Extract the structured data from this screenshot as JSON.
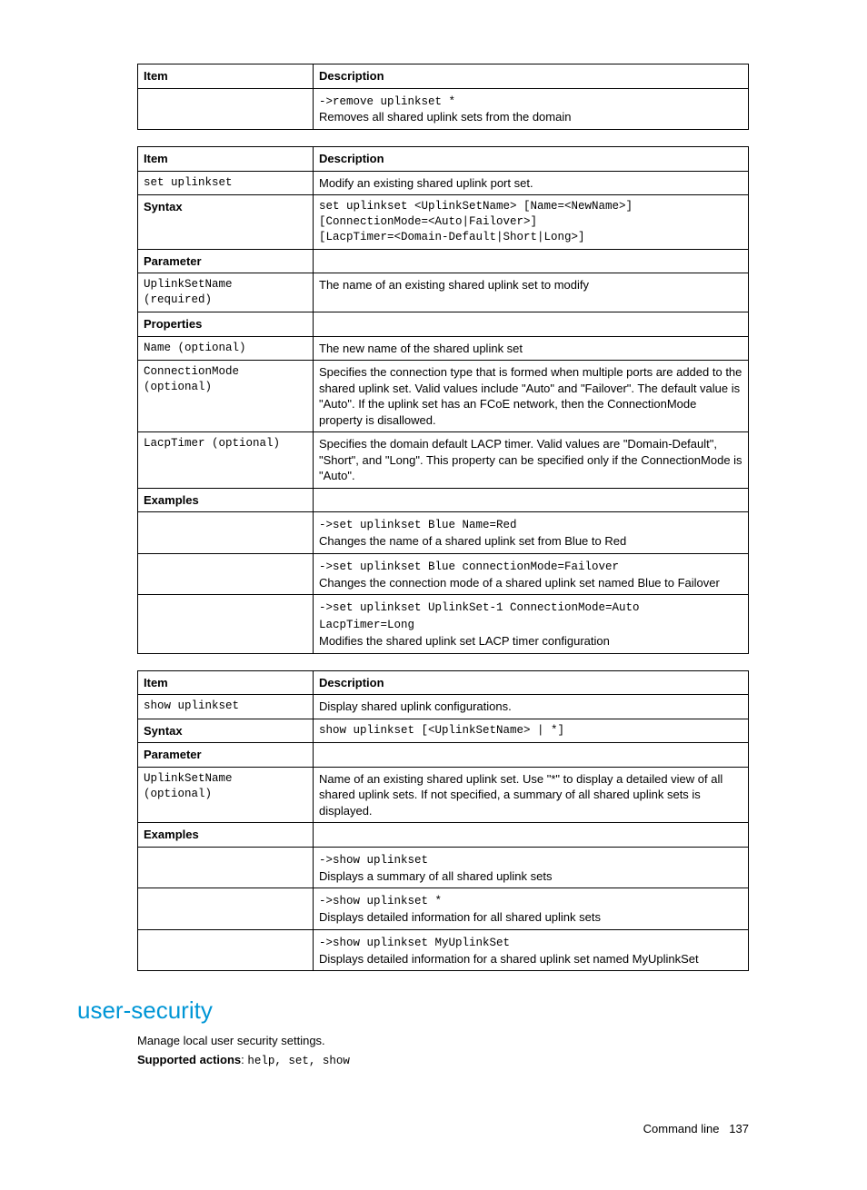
{
  "table1": {
    "headers": [
      "Item",
      "Description"
    ],
    "rows": [
      {
        "c1": "",
        "c2_code": "->remove uplinkset *",
        "c2_text": "Removes all shared uplink sets from the domain"
      }
    ]
  },
  "table2": {
    "headers": [
      "Item",
      "Description"
    ],
    "rows": [
      {
        "c1_mono": "set uplinkset",
        "c2_text": "Modify an existing shared uplink port set."
      },
      {
        "c1_bold": "Syntax",
        "c2_code_multi": [
          "set uplinkset <UplinkSetName> [Name=<NewName>]",
          "[ConnectionMode=<Auto|Failover>]",
          "[LacpTimer=<Domain-Default|Short|Long>]"
        ]
      },
      {
        "c1_bold": "Parameter",
        "c2_text": ""
      },
      {
        "c1_mono_multi": [
          "UplinkSetName",
          "(required)"
        ],
        "c2_text": "The name of an existing shared uplink set to modify"
      },
      {
        "c1_bold": "Properties",
        "c2_text": ""
      },
      {
        "c1_mono": "Name (optional)",
        "c2_text": "The new name of the shared uplink set"
      },
      {
        "c1_mono_multi": [
          "ConnectionMode",
          "(optional)"
        ],
        "c2_text": "Specifies the connection type that is formed when multiple ports are added to the shared uplink set. Valid values include \"Auto\" and \"Failover\". The default value is \"Auto\". If the uplink set has an FCoE network, then the ConnectionMode property is disallowed."
      },
      {
        "c1_mono": "LacpTimer (optional)",
        "c2_text": "Specifies the domain default LACP timer. Valid values are \"Domain-Default\", \"Short\", and \"Long\". This property can be specified only if the ConnectionMode is \"Auto\"."
      },
      {
        "c1_bold": "Examples",
        "c2_text": ""
      },
      {
        "c1": "",
        "c2_code": "->set uplinkset Blue Name=Red",
        "c2_text": "Changes the name of a shared uplink set from Blue to Red"
      },
      {
        "c1": "",
        "c2_code": "->set uplinkset Blue connectionMode=Failover",
        "c2_text": "Changes the connection mode of a shared uplink set named Blue to Failover"
      },
      {
        "c1": "",
        "c2_code_multi": [
          "->set uplinkset UplinkSet-1 ConnectionMode=Auto",
          "LacpTimer=Long"
        ],
        "c2_text": "Modifies the shared uplink set LACP timer configuration"
      }
    ]
  },
  "table3": {
    "headers": [
      "Item",
      "Description"
    ],
    "rows": [
      {
        "c1_mono": "show uplinkset",
        "c2_text": "Display shared uplink configurations."
      },
      {
        "c1_bold": "Syntax",
        "c2_code": "show uplinkset [<UplinkSetName> | *]"
      },
      {
        "c1_bold": "Parameter",
        "c2_text": ""
      },
      {
        "c1_mono_multi": [
          "UplinkSetName",
          "(optional)"
        ],
        "c2_text": "Name of an existing shared uplink set. Use \"*\" to display a detailed view of all shared uplink sets. If not specified, a summary of all shared uplink sets is displayed."
      },
      {
        "c1_bold": "Examples",
        "c2_text": ""
      },
      {
        "c1": "",
        "c2_code": "->show uplinkset",
        "c2_text": "Displays a summary of all shared uplink sets"
      },
      {
        "c1": "",
        "c2_code": "->show uplinkset *",
        "c2_text": "Displays detailed information for all shared uplink sets"
      },
      {
        "c1": "",
        "c2_code": "->show uplinkset MyUplinkSet",
        "c2_text": "Displays detailed information for a shared uplink set named MyUplinkSet"
      }
    ]
  },
  "section": {
    "heading": "user-security",
    "intro": "Manage local user security settings.",
    "supported_label": "Supported actions",
    "supported_value": "help, set, show"
  },
  "footer": {
    "label": "Command line",
    "page": "137"
  }
}
